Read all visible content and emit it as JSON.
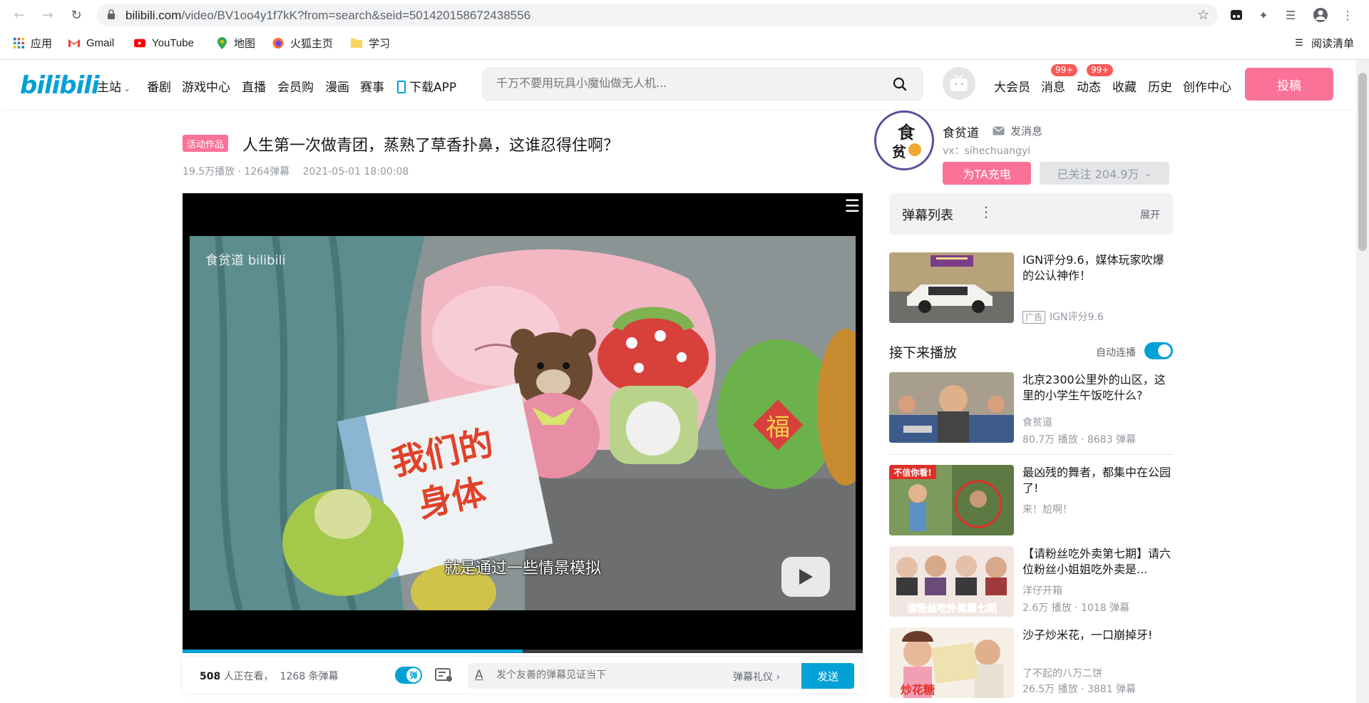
{
  "browser": {
    "url_host": "bilibili.com",
    "url_path": "/video/BV1oo4y1f7kK?from=search&seid=501420158672438556",
    "bookmarks": [
      {
        "label": "应用",
        "icon": "apps-grid-icon"
      },
      {
        "label": "Gmail",
        "icon": "gmail-icon"
      },
      {
        "label": "YouTube",
        "icon": "youtube-icon"
      },
      {
        "label": "地图",
        "icon": "maps-pin-icon"
      },
      {
        "label": "火狐主页",
        "icon": "firefox-icon"
      },
      {
        "label": "学习",
        "icon": "folder-icon"
      }
    ],
    "reading_list": "阅读清单"
  },
  "header": {
    "logo": "bilibili",
    "nav": [
      "主站",
      "番剧",
      "游戏中心",
      "直播",
      "会员购",
      "漫画",
      "赛事",
      "下载APP"
    ],
    "search_placeholder": "千万不要用玩具小魔仙做无人机...",
    "links": [
      "大会员",
      "消息",
      "动态",
      "收藏",
      "历史",
      "创作中心"
    ],
    "badge_messages": "99+",
    "badge_dynamic": "99+",
    "upload": "投稿"
  },
  "video": {
    "tag": "活动作品",
    "title": "人生第一次做青团，蒸熟了草香扑鼻，这谁忍得住啊？",
    "plays": "19.5万播放 · 1264弹幕",
    "date": "2021-05-01 18:00:08",
    "watermark": "食贫道 bilibili",
    "subtitle": "就是通过一些情景模拟",
    "book_text": "我们的\n身体",
    "progress": 0.5
  },
  "danmaku_bar": {
    "viewers_count": "508",
    "viewers_text": "人正在看，",
    "danmaku_count": "1268 条弹幕",
    "toggle_label": "弹",
    "input_placeholder": "发个友善的弹幕见证当下",
    "etiquette": "弹幕礼仪 ›",
    "send": "发送"
  },
  "uploader": {
    "name": "食贫道",
    "message": "发消息",
    "desc": "vx：sihechuangyi",
    "charge": "为TA充电",
    "follow": "已关注 204.9万"
  },
  "danmaku_list": {
    "title": "弹幕列表",
    "expand": "展开"
  },
  "ad": {
    "title": "IGN评分9.6，媒体玩家吹爆的公认神作！",
    "tag": "广告",
    "source": "IGN评分9.6"
  },
  "next_up": {
    "title": "接下来播放",
    "autoplay": "自动连播"
  },
  "recommendations": [
    {
      "title": "北京2300公里外的山区，这里的小学生午饭吃什么?",
      "author": "食贫道",
      "stats": "80.7万 播放 · 8683 弹幕"
    },
    {
      "title": "最凶残的舞者，都集中在公园了!",
      "author": "来！尬啊！",
      "stats": "",
      "thumb_label": "不信你看!"
    },
    {
      "title": "【请粉丝吃外卖第七期】请六位粉丝小姐姐吃外卖是...",
      "author": "洋仔开箱",
      "stats": "2.6万 播放 · 1018 弹幕",
      "thumb_label": "请粉丝吃外卖第七期"
    },
    {
      "title": "沙子炒米花，一口崩掉牙!",
      "author": "了不起的八万二饼",
      "stats": "26.5万 播放 · 3881 弹幕",
      "thumb_label": "炒花糖"
    }
  ],
  "colors": {
    "accent_blue": "#00a1d6",
    "accent_pink": "#fb7299"
  }
}
